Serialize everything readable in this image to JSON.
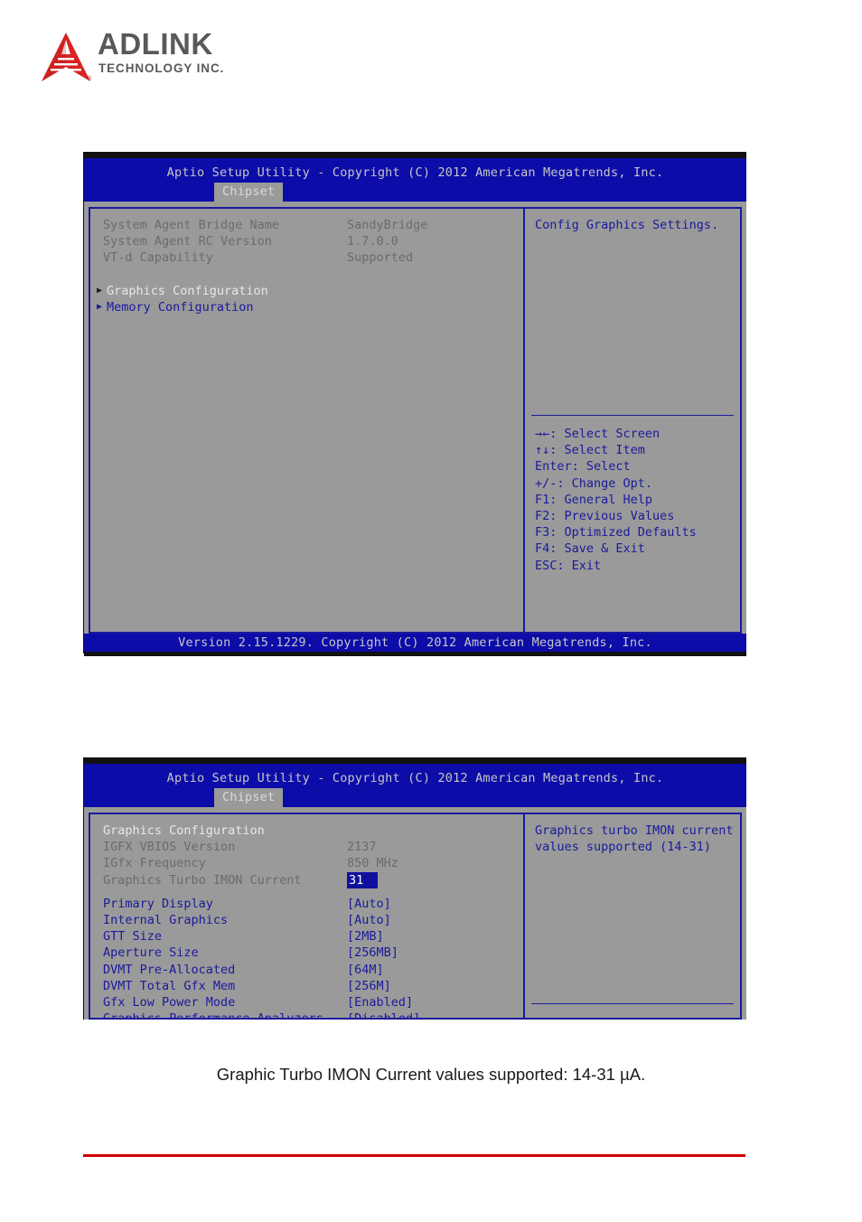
{
  "brand": {
    "name": "ADLINK",
    "tagline": "TECHNOLOGY INC.",
    "registered_mark": "®",
    "logo_color": "#d82323",
    "text_color": "#58595b"
  },
  "screens": [
    {
      "id": "chipset-main",
      "title": "Aptio Setup Utility - Copyright (C) 2012 American Megatrends, Inc.",
      "tabs": [
        {
          "label": "Chipset",
          "active": true
        }
      ],
      "info_rows": [
        {
          "label": "System Agent Bridge Name",
          "value": "SandyBridge"
        },
        {
          "label": "System Agent RC Version",
          "value": "1.7.0.0"
        },
        {
          "label": "VT-d Capability",
          "value": "Supported"
        }
      ],
      "submenus": [
        {
          "marker": "▶",
          "label": "Graphics Configuration",
          "selected": true
        },
        {
          "marker": "▶",
          "label": "Memory Configuration",
          "selected": false
        }
      ],
      "help": {
        "lines": [
          "Config Graphics Settings."
        ]
      },
      "legend": [
        "→←: Select Screen",
        "↑↓: Select Item",
        "Enter: Select",
        "+/-: Change Opt.",
        "F1: General Help",
        "F2: Previous Values",
        "F3: Optimized Defaults",
        "F4: Save & Exit",
        "ESC: Exit"
      ],
      "footer": "Version 2.15.1229. Copyright (C) 2012 American Megatrends, Inc."
    },
    {
      "id": "graphics-configuration",
      "title": "Aptio Setup Utility - Copyright (C) 2012 American Megatrends, Inc.",
      "tabs": [
        {
          "label": "Chipset",
          "active": true
        }
      ],
      "section_header": "Graphics Configuration",
      "info_rows": [
        {
          "label": "IGFX VBIOS Version",
          "value": "2137"
        },
        {
          "label": "IGfx Frequency",
          "value": "850 MHz"
        }
      ],
      "selected_field": {
        "label": "Graphics Turbo IMON Current",
        "value": "31"
      },
      "options": [
        {
          "label": "Primary Display",
          "value": "[Auto]"
        },
        {
          "label": "Internal Graphics",
          "value": "[Auto]"
        },
        {
          "label": "GTT Size",
          "value": "[2MB]"
        },
        {
          "label": "Aperture Size",
          "value": "[256MB]"
        },
        {
          "label": "DVMT Pre-Allocated",
          "value": "[64M]"
        },
        {
          "label": "DVMT Total Gfx Mem",
          "value": "[256M]"
        },
        {
          "label": "Gfx Low Power Mode",
          "value": "[Enabled]"
        },
        {
          "label": "Graphics Performance Analyzers",
          "value": "[Disabled]"
        }
      ],
      "help": {
        "lines": [
          "Graphics turbo IMON current",
          "values supported (14-31)"
        ]
      }
    }
  ],
  "caption": "Graphic Turbo IMON Current values supported: 14-31 µA.",
  "colors": {
    "bios_blue": "#0c0ca8",
    "bios_gray": "#9a9a9a",
    "accent_red": "#cc0000",
    "text_blue": "#1a1a9c"
  }
}
